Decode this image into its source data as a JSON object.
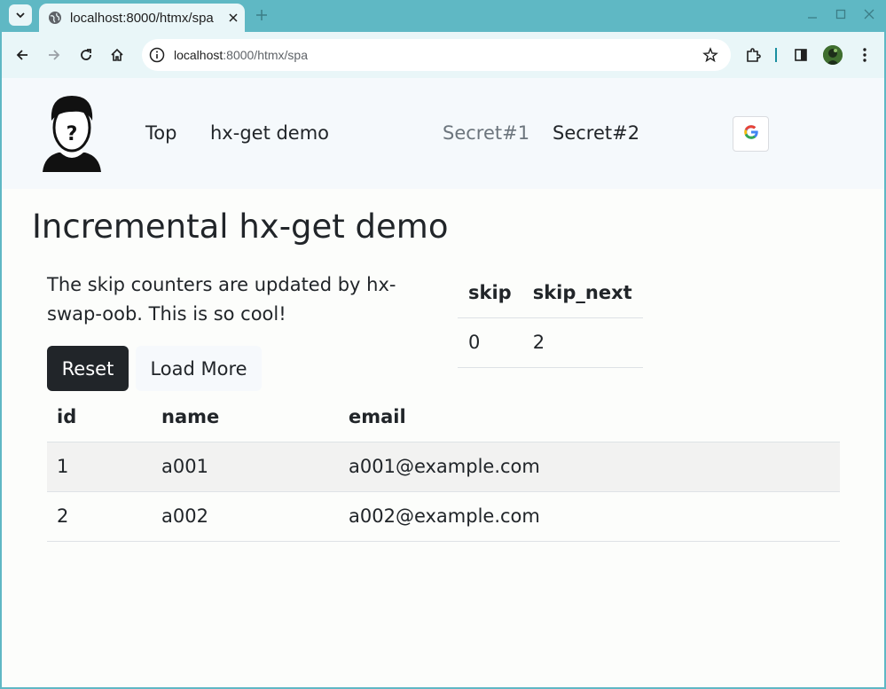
{
  "browser": {
    "tab_title": "localhost:8000/htmx/spa",
    "url_host": "localhost",
    "url_rest": ":8000/htmx/spa",
    "icons": {
      "tab_menu": "chevron-down-icon",
      "tab_favicon": "globe-icon",
      "tab_close": "close-icon",
      "new_tab": "plus-icon",
      "back": "arrow-left-icon",
      "forward": "arrow-right-icon",
      "reload": "reload-icon",
      "home": "home-icon",
      "site_info": "info-icon",
      "bookmark": "star-icon",
      "extensions": "puzzle-icon",
      "side_panel": "side-panel-icon",
      "profile": "avatar-icon",
      "menu": "kebab-menu-icon"
    },
    "colors": {
      "frame": "#5fb8c4",
      "toolbar": "#e9f6f8"
    }
  },
  "navbar": {
    "links": [
      {
        "label": "Top"
      },
      {
        "label": "hx-get demo"
      },
      {
        "label": "Secret#1"
      },
      {
        "label": "Secret#2"
      }
    ],
    "google_button_icon": "google-icon"
  },
  "main": {
    "title": "Incremental hx-get demo",
    "description": "The skip counters are updated by hx-swap-oob. This is so cool!",
    "skip_table": {
      "headers": [
        "skip",
        "skip_next"
      ],
      "row": [
        "0",
        "2"
      ]
    },
    "buttons": {
      "reset": "Reset",
      "load_more": "Load More"
    },
    "data_table": {
      "headers": [
        "id",
        "name",
        "email"
      ],
      "rows": [
        [
          "1",
          "a001",
          "a001@example.com"
        ],
        [
          "2",
          "a002",
          "a002@example.com"
        ]
      ]
    }
  }
}
